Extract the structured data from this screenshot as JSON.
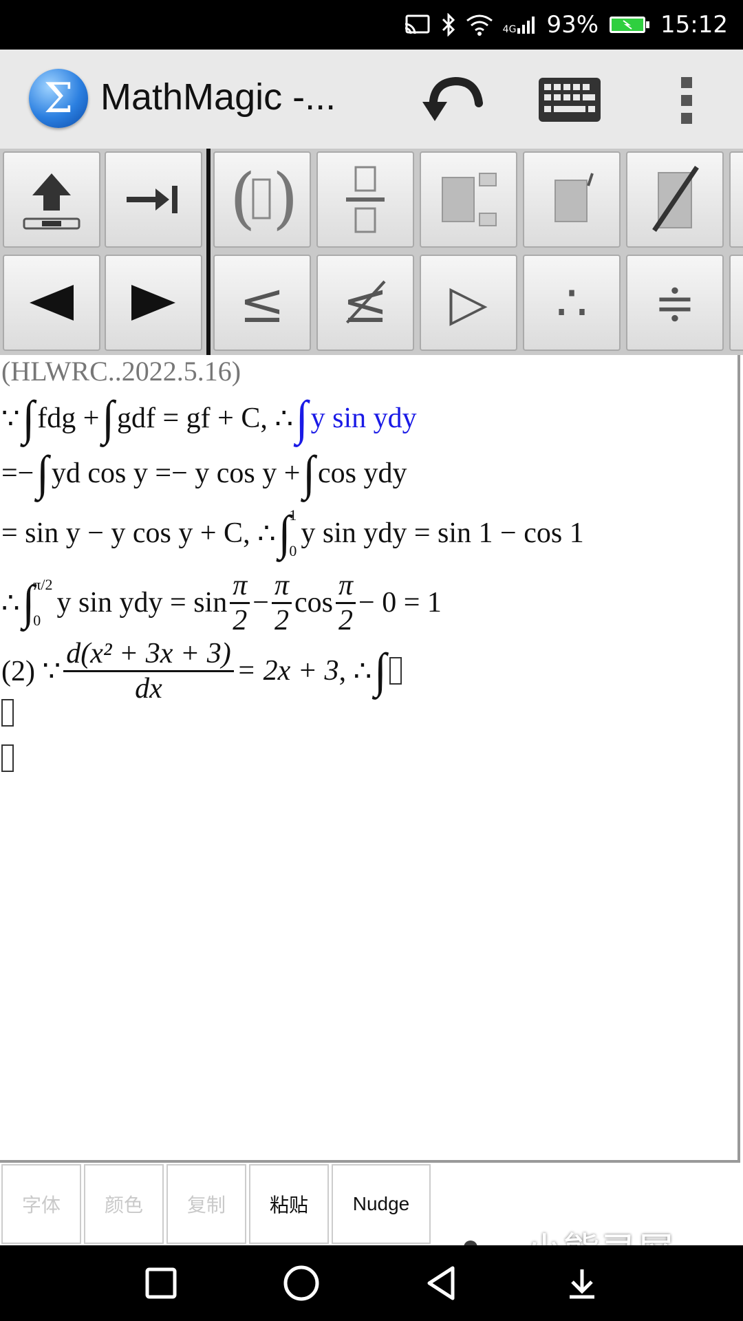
{
  "status_bar": {
    "network": "4G",
    "battery": "93%",
    "time": "15:12"
  },
  "app_bar": {
    "title": "MathMagic  -...",
    "logo_glyph": "Σ"
  },
  "palette": {
    "row1": [
      "shift-up",
      "tab",
      "parentheses",
      "fraction",
      "sub-superscript",
      "prime",
      "strikethrough"
    ],
    "row2": [
      "◀",
      "▶",
      "≤",
      "≰",
      "▷",
      "∴",
      "≑"
    ]
  },
  "document": {
    "line1": "(HLWRC..2022.5.16)",
    "line2a": "∵",
    "line2b": "fdg +",
    "line2c": "gdf = gf + C",
    "line2d": ", ∴",
    "line2e": "y sin ydy",
    "line3a": "=−",
    "line3b": "yd cos y =− y cos y +",
    "line3c": "cos ydy",
    "line4a": "= sin y − y cos y + C",
    "line4b": ", ∴",
    "line4_upper": "1",
    "line4_lower": "0",
    "line4c": "y sin ydy = sin 1 − cos 1",
    "line5a": "∴",
    "line5_upper": "π/2",
    "line5_lower": "0",
    "line5b": "y sin ydy = sin",
    "line5_pi": "π",
    "line5_two": "2",
    "line5c": "−",
    "line5d": "cos",
    "line5e": "− 0 = 1",
    "line6a": "(2) ∵",
    "line6_num": "d(x² + 3x + 3)",
    "line6_den": "dx",
    "line6b": "= 2x + 3",
    "line6c": ", ∴"
  },
  "toolbar": {
    "font_label": "字体",
    "color_label": "颜色",
    "copy_label": "复制",
    "paste_label": "粘贴",
    "nudge_label": "Nudge"
  },
  "watermark": {
    "text": "小熊录屏"
  },
  "colors": {
    "accent_blue": "#1a1ae6"
  }
}
